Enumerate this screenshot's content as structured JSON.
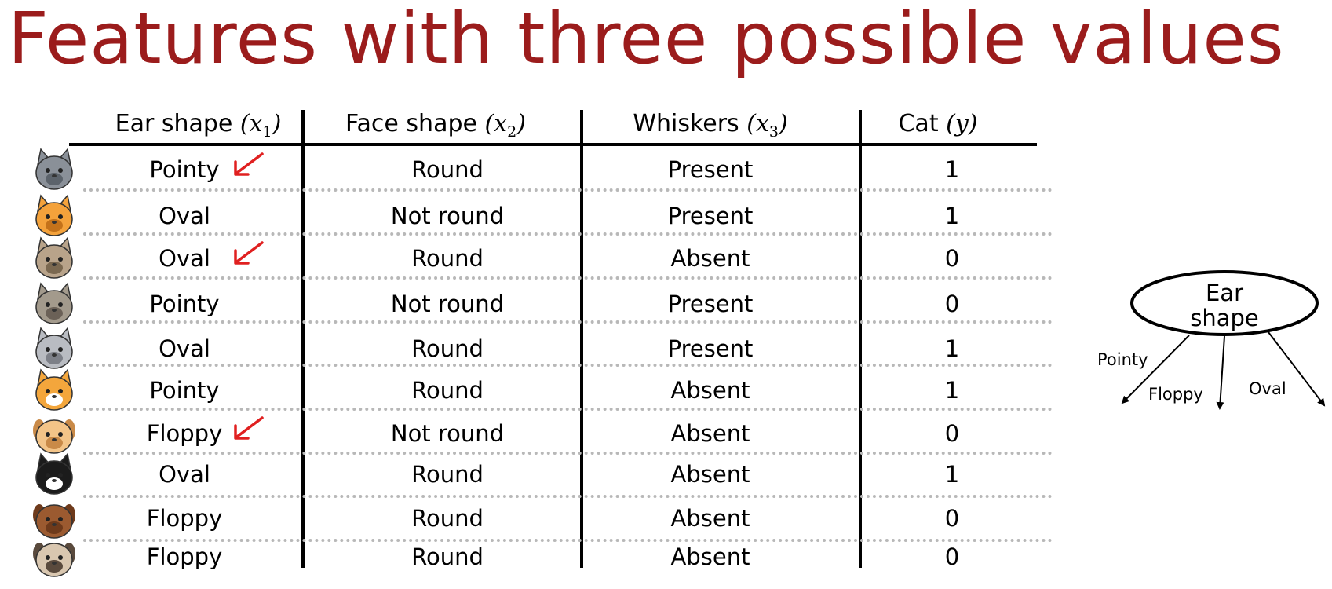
{
  "title": "Features with three possible values",
  "table": {
    "headers": [
      {
        "text": "Ear shape ",
        "var": "x",
        "sub": "1"
      },
      {
        "text": "Face shape  ",
        "var": "x",
        "sub": "2"
      },
      {
        "text": "Whiskers ",
        "var": "x",
        "sub": "3"
      },
      {
        "text": "Cat ",
        "var": "y",
        "sub": ""
      }
    ],
    "rows": [
      {
        "ear": "Pointy",
        "face": "Round",
        "whiskers": "Present",
        "cat": "1",
        "marked": true,
        "animal": "gray-cat-icon"
      },
      {
        "ear": "Oval",
        "face": "Not round",
        "whiskers": "Present",
        "cat": "1",
        "marked": false,
        "animal": "orange-cat-icon"
      },
      {
        "ear": "Oval",
        "face": "Round",
        "whiskers": "Absent",
        "cat": "0",
        "marked": true,
        "animal": "hamster-icon"
      },
      {
        "ear": "Pointy",
        "face": "Not round",
        "whiskers": "Present",
        "cat": "0",
        "marked": false,
        "animal": "raccoon-icon"
      },
      {
        "ear": "Oval",
        "face": "Round",
        "whiskers": "Present",
        "cat": "1",
        "marked": false,
        "animal": "gray-hamster-icon"
      },
      {
        "ear": "Pointy",
        "face": "Round",
        "whiskers": "Absent",
        "cat": "1",
        "marked": false,
        "animal": "orange-white-cat-icon"
      },
      {
        "ear": "Floppy",
        "face": "Not round",
        "whiskers": "Absent",
        "cat": "0",
        "marked": true,
        "animal": "tan-dog-icon"
      },
      {
        "ear": "Oval",
        "face": "Round",
        "whiskers": "Absent",
        "cat": "1",
        "marked": false,
        "animal": "black-white-cat-icon"
      },
      {
        "ear": "Floppy",
        "face": "Round",
        "whiskers": "Absent",
        "cat": "0",
        "marked": false,
        "animal": "brown-dog-icon"
      },
      {
        "ear": "Floppy",
        "face": "Round",
        "whiskers": "Absent",
        "cat": "0",
        "marked": false,
        "animal": "pug-icon"
      }
    ]
  },
  "tree": {
    "node_line1": "Ear",
    "node_line2": "shape",
    "branches": [
      "Pointy",
      "Floppy",
      "Oval"
    ]
  },
  "colors": {
    "title": "#9B1C1C",
    "arrow": "#E02020"
  }
}
